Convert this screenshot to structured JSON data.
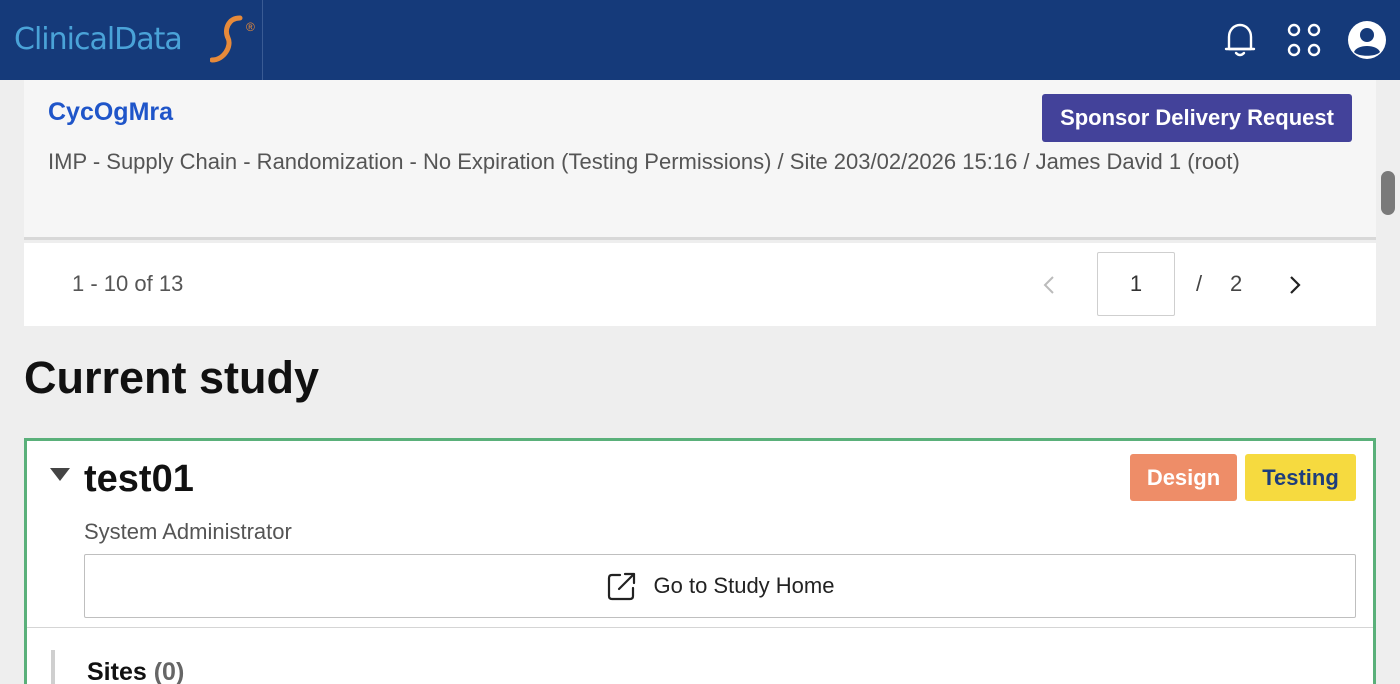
{
  "header": {
    "logo_text": "ClinicalData",
    "logo_reg": "®",
    "icons": [
      "bell-icon",
      "apps-grid-icon",
      "user-avatar-icon"
    ],
    "brand_color": "#153a7a"
  },
  "request": {
    "id": "CycOgMra",
    "action_label": "Sponsor Delivery Request",
    "detail": "IMP - Supply Chain - Randomization - No Expiration (Testing Permissions) / Site 203/02/2026 15:16 / James David 1 (root)"
  },
  "pagination": {
    "range": "1 - 10 of 13",
    "current_page": "1",
    "slash": "/",
    "total_pages": "2"
  },
  "current_study": {
    "title": "Current study",
    "name": "test01",
    "role": "System Administrator",
    "badges": {
      "design": "Design",
      "testing": "Testing"
    },
    "go_home_label": "Go to Study Home",
    "sites_label": "Sites",
    "sites_count": "(0)"
  },
  "colors": {
    "accent_purple": "#43429a",
    "link_blue": "#1f55c9",
    "study_border": "#5ab07a",
    "design_badge": "#ee8d68",
    "testing_badge": "#f6da3f"
  }
}
